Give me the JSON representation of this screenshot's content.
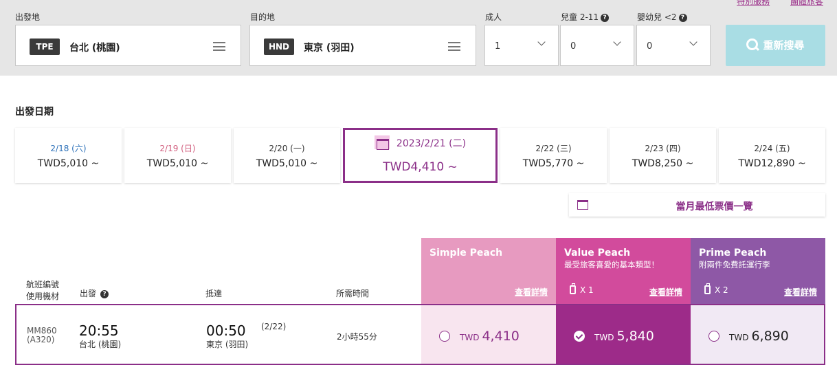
{
  "header_links": [
    "特別服務",
    "團體旅客"
  ],
  "search": {
    "origin_label": "出發地",
    "origin_code": "TPE",
    "origin_name": "台北 (桃園)",
    "dest_label": "目的地",
    "dest_code": "HND",
    "dest_name": "東京 (羽田)",
    "adult_label": "成人",
    "adult_value": "1",
    "child_label": "兒童 2-11",
    "child_value": "0",
    "infant_label": "嬰幼兒 <2",
    "infant_value": "0",
    "button_label": "重新搜尋"
  },
  "dates": {
    "title": "出發日期",
    "items": [
      {
        "date": "2/18 (六)",
        "price": "TWD5,010 ~"
      },
      {
        "date": "2/19 (日)",
        "price": "TWD5,010 ~"
      },
      {
        "date": "2/20 (一)",
        "price": "TWD5,010 ~"
      },
      {
        "date": "2023/2/21 (二)",
        "price": "TWD4,410 ~"
      },
      {
        "date": "2/22 (三)",
        "price": "TWD5,770 ~"
      },
      {
        "date": "2/23 (四)",
        "price": "TWD8,250 ~"
      },
      {
        "date": "2/24 (五)",
        "price": "TWD12,890 ~"
      }
    ],
    "month_low_label": "當月最低票價一覽"
  },
  "columns": {
    "flight_no_line1": "航班編號",
    "flight_no_line2": "使用機材",
    "depart": "出發",
    "arrive": "抵達",
    "duration": "所需時間"
  },
  "fares": [
    {
      "name": "Simple Peach",
      "desc": "",
      "bag": "",
      "details": "查看詳情",
      "currency": "TWD",
      "price": "4,410",
      "head_color": "#e79ac0",
      "cell_color": "#f8e5ef"
    },
    {
      "name": "Value Peach",
      "desc": "最受旅客喜愛的基本類型！",
      "bag": "X 1",
      "details": "查看詳情",
      "currency": "TWD",
      "price": "5,840",
      "head_color": "#d24b9c",
      "cell_color": "#9d2b89"
    },
    {
      "name": "Prime Peach",
      "desc": "附兩件免費託運行李",
      "bag": "X 2",
      "details": "查看詳情",
      "currency": "TWD",
      "price": "6,890",
      "head_color": "#8e58a6",
      "cell_color": "#f1e9f4"
    }
  ],
  "flight": {
    "number": "MM860",
    "aircraft": "(A320)",
    "depart_time": "20:55",
    "depart_airport": "台北 (桃園)",
    "arrive_time": "00:50",
    "arrive_date": "(2/22)",
    "arrive_airport": "東京 (羽田)",
    "duration": "2小時55分"
  }
}
